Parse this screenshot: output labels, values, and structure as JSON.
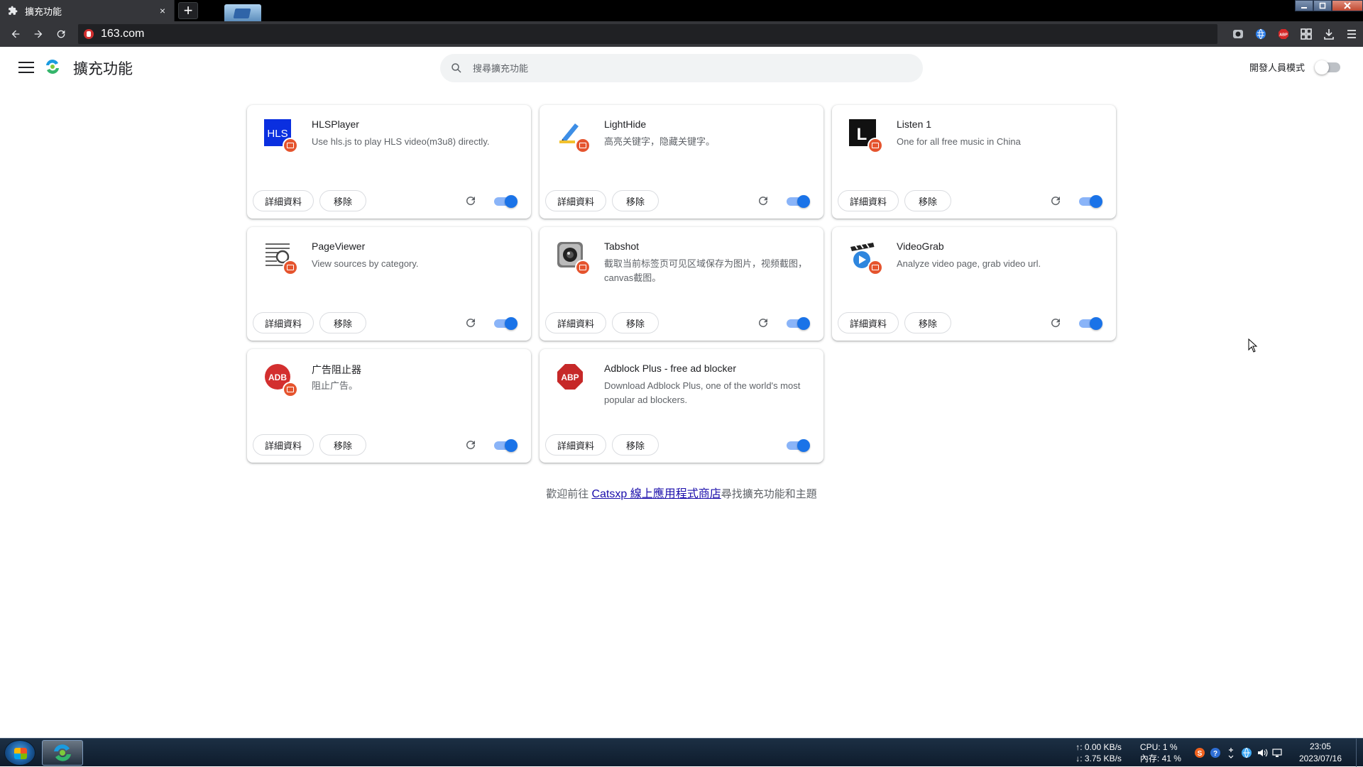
{
  "browser": {
    "tab_title": "擴充功能",
    "tab_close": "×",
    "new_tab": "+",
    "url": "163.com"
  },
  "header": {
    "title": "擴充功能",
    "search_placeholder": "搜尋擴充功能",
    "devmode_label": "開發人員模式",
    "devmode_on": false
  },
  "buttons": {
    "details": "詳細資料",
    "remove": "移除"
  },
  "extensions": [
    {
      "name": "HLSPlayer",
      "description": "Use hls.js to play HLS video(m3u8) directly.",
      "enabled": true,
      "icon": "hls-icon",
      "icon_text": "HLS",
      "reload": true
    },
    {
      "name": "LightHide",
      "description": "高亮关键字，隐藏关键字。",
      "enabled": true,
      "icon": "pen-highlight-icon",
      "reload": true
    },
    {
      "name": "Listen 1",
      "description": "One for all free music in China",
      "enabled": true,
      "icon": "listen1-icon",
      "icon_text": "L",
      "reload": true
    },
    {
      "name": "PageViewer",
      "description": "View sources by category.",
      "enabled": true,
      "icon": "page-magnifier-icon",
      "reload": true
    },
    {
      "name": "Tabshot",
      "description": "截取当前标签页可见区域保存为图片，视频截图，canvas截图。",
      "enabled": true,
      "icon": "camera-icon",
      "reload": true
    },
    {
      "name": "VideoGrab",
      "description": "Analyze video page, grab video url.",
      "enabled": true,
      "icon": "clapperboard-icon",
      "reload": true
    },
    {
      "name": "广告阻止器",
      "description": "阻止广告。",
      "enabled": true,
      "icon": "adb-icon",
      "icon_text": "ADB",
      "reload": true
    },
    {
      "name": "Adblock Plus - free ad blocker",
      "description": "Download Adblock Plus, one of the world's most popular ad blockers.",
      "enabled": true,
      "icon": "abp-icon",
      "icon_text": "ABP",
      "reload": false
    }
  ],
  "footer": {
    "prefix": "歡迎前往 ",
    "link": "Catsxp 線上應用程式商店",
    "suffix": "尋找擴充功能和主題"
  },
  "taskbar": {
    "net_up": "↑: 0.00 KB/s",
    "net_down": "↓: 3.75 KB/s",
    "cpu": "CPU: 1 %",
    "mem": "內存: 41 %",
    "time": "23:05",
    "date": "2023/07/16"
  },
  "colors": {
    "accent": "#1a73e8",
    "toggle_track": "#8ab4f8",
    "badge": "#e5542e",
    "link": "#1a0dab"
  }
}
